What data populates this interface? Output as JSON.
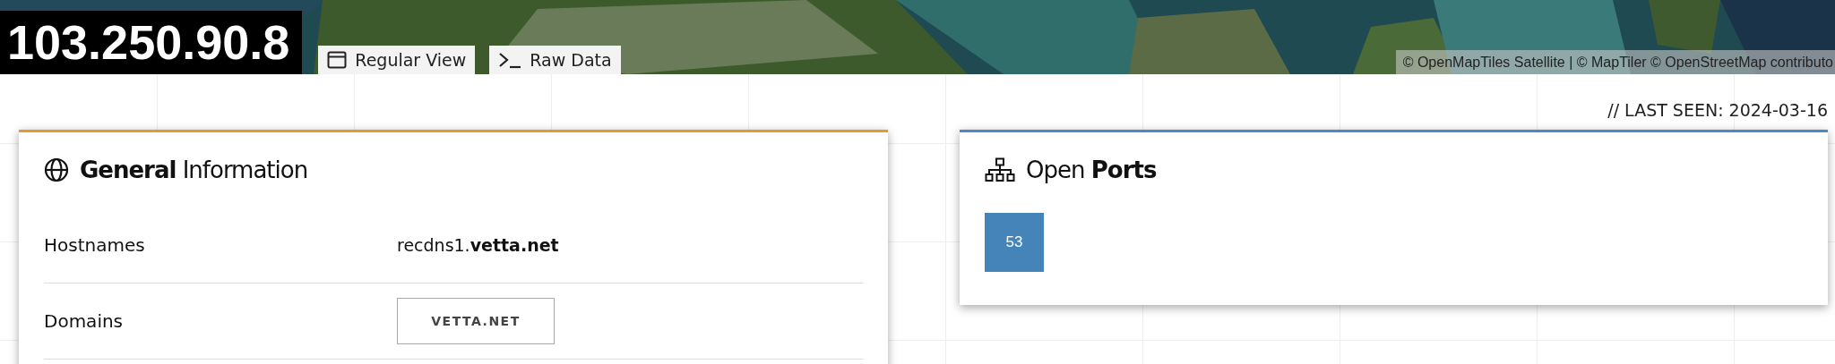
{
  "header": {
    "ip": "103.250.90.8",
    "tabs": [
      {
        "label": "Regular View",
        "kind": "window"
      },
      {
        "label": "Raw Data",
        "kind": "terminal"
      }
    ],
    "attribution": "© OpenMapTiles Satellite | © MapTiler © OpenStreetMap contributo"
  },
  "general": {
    "title_bold": "General",
    "title_rest": "Information",
    "rows": [
      {
        "kind": "text",
        "label": "Hostnames",
        "value": "recdns1.**vetta.net**"
      },
      {
        "kind": "tag",
        "label": "Domains",
        "value": "VETTA.NET"
      }
    ]
  },
  "last_seen": "// LAST SEEN: 2024-03-16",
  "ports": {
    "title_rest": "Open",
    "title_bold": "Ports",
    "items": [
      "53"
    ]
  }
}
